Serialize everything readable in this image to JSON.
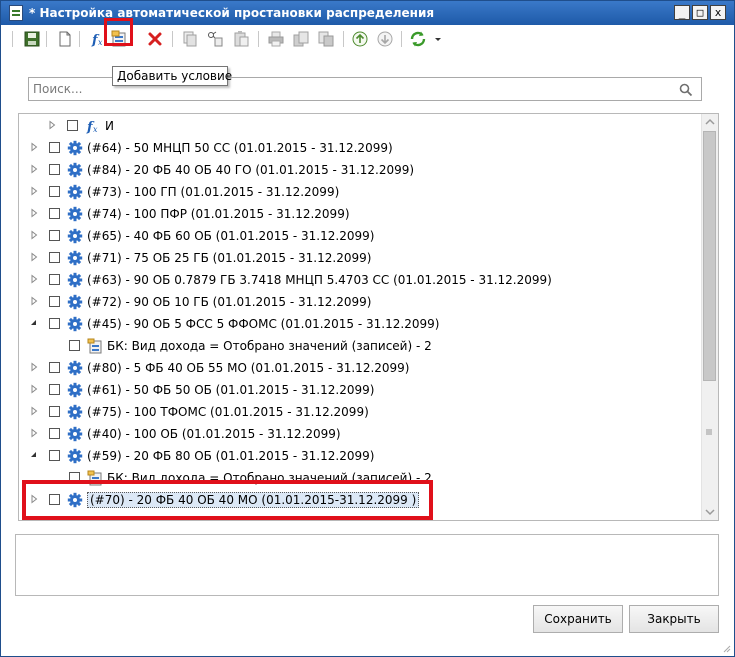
{
  "window": {
    "title": "* Настройка автоматической простановки распределения",
    "min_label": "_",
    "max_label": "□",
    "close_label": "x"
  },
  "tooltip": {
    "text": "Добавить условие"
  },
  "search": {
    "placeholder": "Поиск..."
  },
  "tree": {
    "rows": [
      {
        "text": "И",
        "icon": "function-icon",
        "expander": "collapsed"
      },
      {
        "text": "(#64) - 50 МНЦП 50 СС (01.01.2015 - 31.12.2099)",
        "icon": "gear-icon",
        "expander": "collapsed"
      },
      {
        "text": "(#84) - 20 ФБ 40 ОБ 40 ГО (01.01.2015 - 31.12.2099)",
        "icon": "gear-icon",
        "expander": "collapsed"
      },
      {
        "text": "(#73) - 100 ГП (01.01.2015 - 31.12.2099)",
        "icon": "gear-icon",
        "expander": "collapsed"
      },
      {
        "text": "(#74) - 100 ПФР (01.01.2015 - 31.12.2099)",
        "icon": "gear-icon",
        "expander": "collapsed"
      },
      {
        "text": "(#65) - 40 ФБ 60 ОБ (01.01.2015 - 31.12.2099)",
        "icon": "gear-icon",
        "expander": "collapsed"
      },
      {
        "text": "(#71) - 75 ОБ 25 ГБ (01.01.2015 - 31.12.2099)",
        "icon": "gear-icon",
        "expander": "collapsed"
      },
      {
        "text": "(#63) - 90 ОБ 0.7879 ГБ 3.7418 МНЦП 5.4703 СС (01.01.2015 - 31.12.2099)",
        "icon": "gear-icon",
        "expander": "collapsed"
      },
      {
        "text": "(#72) - 90 ОБ 10 ГБ (01.01.2015 - 31.12.2099)",
        "icon": "gear-icon",
        "expander": "collapsed"
      },
      {
        "text": "(#45) - 90 ОБ 5 ФСС 5 ФФОМС (01.01.2015 - 31.12.2099)",
        "icon": "gear-icon",
        "expander": "expanded"
      },
      {
        "text": "БК: Вид дохода = Отобрано значений (записей) - 2",
        "icon": "condition-icon",
        "expander": "none"
      },
      {
        "text": "(#80) - 5 ФБ 40 ОБ 55 МО (01.01.2015 - 31.12.2099)",
        "icon": "gear-icon",
        "expander": "collapsed"
      },
      {
        "text": "(#61) - 50 ФБ 50 ОБ (01.01.2015 - 31.12.2099)",
        "icon": "gear-icon",
        "expander": "collapsed"
      },
      {
        "text": "(#75) - 100 ТФОМС (01.01.2015 - 31.12.2099)",
        "icon": "gear-icon",
        "expander": "collapsed"
      },
      {
        "text": "(#40) - 100 ОБ (01.01.2015 - 31.12.2099)",
        "icon": "gear-icon",
        "expander": "collapsed"
      },
      {
        "text": "(#59) - 20 ФБ 80 ОБ (01.01.2015 - 31.12.2099)",
        "icon": "gear-icon",
        "expander": "expanded"
      },
      {
        "text": "БК: Вид дохода = Отобрано значений (записей) - 2",
        "icon": "condition-icon",
        "expander": "none"
      },
      {
        "text": "(#70) - 20 ФБ 40 ОБ 40 МО (01.01.2015-31.12.2099 )",
        "icon": "gear-icon",
        "expander": "collapsed",
        "selected": true
      }
    ]
  },
  "buttons": {
    "save": "Сохранить",
    "close": "Закрыть"
  },
  "colors": {
    "title_bar": "#1e5aa8",
    "highlight": "#e0101a",
    "selection": "#dce8f6",
    "gear": "#2f6fc6"
  }
}
